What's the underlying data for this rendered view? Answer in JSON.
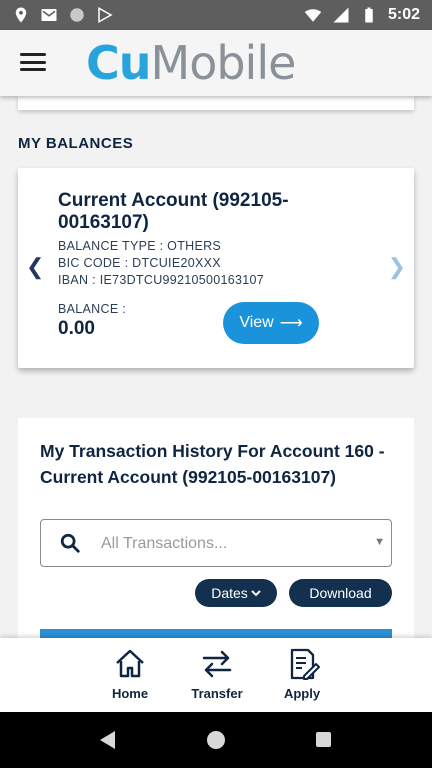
{
  "status_bar": {
    "time": "5:02",
    "left_icons": [
      "location-icon",
      "gmail-icon",
      "circle-icon",
      "play-store-icon"
    ],
    "right_icons": [
      "wifi-icon",
      "signal-icon",
      "battery-icon"
    ]
  },
  "header": {
    "logo_part1": "Cu",
    "logo_part2": "Mobile",
    "menu_icon": "hamburger-menu-icon"
  },
  "balances": {
    "section_title": "MY BALANCES",
    "account_title": "Current Account (992105-00163107)",
    "balance_type": "BALANCE TYPE : OTHERS",
    "bic_code": "BIC CODE : DTCUIE20XXX",
    "iban": "IBAN : IE73DTCU99210500163107",
    "balance_label": "BALANCE :",
    "balance_value": "0.00",
    "view_button": "View"
  },
  "transactions": {
    "title": "My Transaction History For Account 160 - Current Account (992105-00163107)",
    "search_placeholder": "All Transactions...",
    "dates_button": "Dates",
    "download_button": "Download"
  },
  "bottom_nav": {
    "items": [
      {
        "label": "Home",
        "icon": "home-icon"
      },
      {
        "label": "Transfer",
        "icon": "transfer-icon"
      },
      {
        "label": "Apply",
        "icon": "apply-icon"
      }
    ]
  },
  "colors": {
    "brand_blue": "#28a4dd",
    "navy": "#0f2541",
    "button_blue": "#1a93db",
    "pill_navy": "#14304f",
    "status_bar": "#5e5e5e"
  }
}
